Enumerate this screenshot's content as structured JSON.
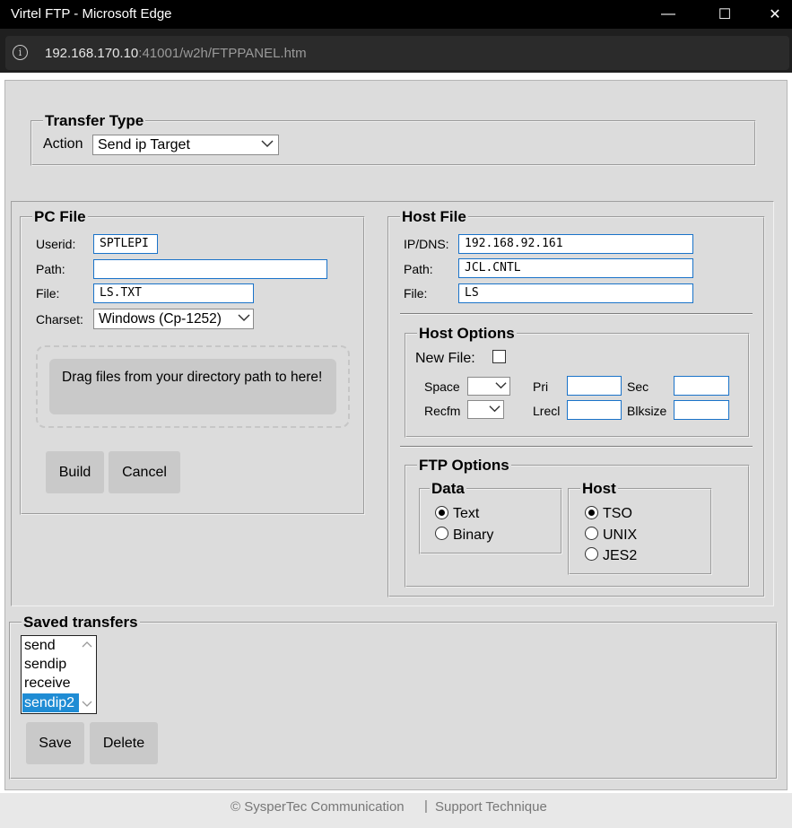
{
  "window": {
    "title": "Virtel FTP - Microsoft Edge",
    "minimize": "—",
    "maximize": "☐",
    "close": "✕"
  },
  "address": {
    "host": "192.168.170.10",
    "rest": ":41001/w2h/FTPPANEL.htm",
    "info_icon": "i"
  },
  "transfer_type": {
    "legend": "Transfer Type",
    "action_label": "Action",
    "action_value": "Send ip Target"
  },
  "pc_file": {
    "legend": "PC File",
    "userid_label": "Userid:",
    "userid_value": "SPTLEPI",
    "path_label": "Path:",
    "path_value": "",
    "file_label": "File:",
    "file_value": "LS.TXT",
    "charset_label": "Charset:",
    "charset_value": "Windows (Cp-1252)",
    "drop_message": "Drag files from your directory path to here!",
    "build_label": "Build",
    "cancel_label": "Cancel"
  },
  "host_file": {
    "legend": "Host File",
    "ipdns_label": "IP/DNS:",
    "ipdns_value": "192.168.92.161",
    "path_label": "Path:",
    "path_value": "JCL.CNTL",
    "file_label": "File:",
    "file_value": "LS"
  },
  "host_options": {
    "legend": "Host Options",
    "new_file_label": "New File:",
    "new_file_checked": false,
    "space_label": "Space",
    "space_value": "",
    "pri_label": "Pri",
    "pri_value": "",
    "sec_label": "Sec",
    "sec_value": "",
    "recfm_label": "Recfm",
    "recfm_value": "",
    "lrecl_label": "Lrecl",
    "lrecl_value": "",
    "blksize_label": "Blksize",
    "blksize_value": ""
  },
  "ftp_options": {
    "legend": "FTP Options",
    "data": {
      "legend": "Data",
      "options": [
        {
          "label": "Text",
          "selected": true
        },
        {
          "label": "Binary",
          "selected": false
        }
      ]
    },
    "host": {
      "legend": "Host",
      "options": [
        {
          "label": "TSO",
          "selected": true
        },
        {
          "label": "UNIX",
          "selected": false
        },
        {
          "label": "JES2",
          "selected": false
        }
      ]
    }
  },
  "saved_transfers": {
    "legend": "Saved transfers",
    "items": [
      {
        "label": "send",
        "selected": false
      },
      {
        "label": "sendip",
        "selected": false
      },
      {
        "label": "receive",
        "selected": false
      },
      {
        "label": "sendip2",
        "selected": true
      }
    ],
    "save_label": "Save",
    "delete_label": "Delete"
  },
  "footer": {
    "copyright": "© SysperTec Communication",
    "separator": "|",
    "support": "Support Technique"
  },
  "colors": {
    "panel_bg": "#dcdcdc",
    "input_border": "#1a73c9",
    "list_selected": "#1f8cd4",
    "button_bg": "#c9c9c9"
  }
}
